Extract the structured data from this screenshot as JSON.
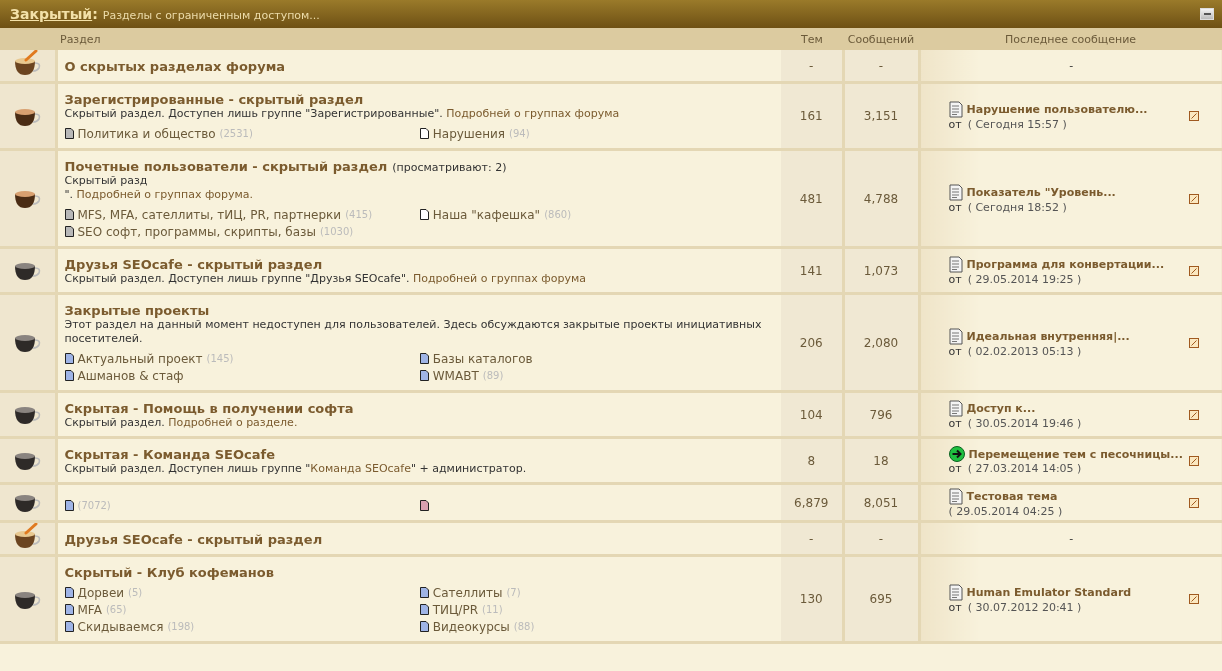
{
  "category": {
    "title": "Закрытый",
    "separator": ":",
    "subtitle": "Разделы с ограниченным доступом...",
    "collapsed": false
  },
  "columns": {
    "forum": "Раздел",
    "topics": "Тем",
    "posts": "Сообщений",
    "last": "Последнее сообщение"
  },
  "forums": [
    {
      "kind": "new",
      "title": "О скрытых разделах форума",
      "topics": "-",
      "posts": "-",
      "last_post": {
        "kind": "none",
        "text": "-"
      }
    },
    {
      "kind": "read",
      "title": "Зарегистрированные - скрытый раздел",
      "description": [
        [
          {
            "text": "Скрытый раздел. Доступен лишь группе \"Зарегистрированные\". ",
            "link": false
          },
          {
            "text": "Подробней о группах форума",
            "link": true
          }
        ]
      ],
      "subforums": {
        "left": [
          {
            "kind": "read",
            "name": "Политика и общество",
            "count": "(2531)"
          }
        ],
        "right": [
          {
            "kind": "empty",
            "name": "Нарушения",
            "count": "(94)"
          }
        ]
      },
      "topics": "161",
      "posts": "3,151",
      "last_post": {
        "kind": "topic",
        "title": "Нарушение пользователю...",
        "by": "от",
        "when": "( Сегодня 15:57 )"
      }
    },
    {
      "kind": "read",
      "title": "Почетные пользователи - скрытый раздел",
      "viewing": "(просматривают: 2)",
      "description": [
        [
          {
            "text": "Скрытый разд",
            "link": false
          }
        ],
        [
          {
            "text": "\". ",
            "link": false
          },
          {
            "text": "Подробней о группах форума.",
            "link": true
          }
        ]
      ],
      "subforums": {
        "left": [
          {
            "kind": "read",
            "name": "MFS, MFA, сателлиты, тИЦ, PR, партнерки",
            "count": "(415)"
          },
          {
            "kind": "read",
            "name": "SEO софт, программы, скрипты, базы",
            "count": "(1030)"
          }
        ],
        "right": [
          {
            "kind": "empty",
            "name": "Наша \"кафешка\"",
            "count": "(860)"
          }
        ]
      },
      "topics": "481",
      "posts": "4,788",
      "last_post": {
        "kind": "topic",
        "title": "Показатель \"Уровень...",
        "by": "от",
        "when": "( Сегодня 18:52 )"
      }
    },
    {
      "kind": "dark",
      "title": "Друзья SEOcafe - скрытый раздел",
      "description": [
        [
          {
            "text": "Скрытый раздел. Доступен лишь группе \"Друзья SEOcafe\". ",
            "link": false
          },
          {
            "text": "Подробней о группах форума",
            "link": true
          }
        ]
      ],
      "topics": "141",
      "posts": "1,073",
      "last_post": {
        "kind": "topic",
        "title": "Программа для конвертации...",
        "by": "от",
        "when": "( 29.05.2014 19:25 )"
      }
    },
    {
      "kind": "dark",
      "title": "Закрытые проекты",
      "description": [
        [
          {
            "text": "Этот раздел на данный момент недоступен для пользователей. Здесь обсуждаются закрытые проекты инициативных посетителей.",
            "link": false
          }
        ]
      ],
      "subforums": {
        "left": [
          {
            "kind": "unread",
            "name": "Актуальный проект",
            "count": "(145)"
          },
          {
            "kind": "unread",
            "name": "Ашманов & стаф"
          }
        ],
        "right": [
          {
            "kind": "unread",
            "name": "Базы каталогов"
          },
          {
            "kind": "unread",
            "name": "WMABT",
            "count": "(89)"
          }
        ]
      },
      "topics": "206",
      "posts": "2,080",
      "last_post": {
        "kind": "topic",
        "title": "Идеальная внутренняя|...",
        "by": "от",
        "when": "( 02.02.2013 05:13 )"
      }
    },
    {
      "kind": "dark",
      "title": "Скрытая - Помощь в получении софта",
      "description": [
        [
          {
            "text": "Скрытый раздел. ",
            "link": false
          },
          {
            "text": "Подробней о разделе.",
            "link": true
          }
        ]
      ],
      "topics": "104",
      "posts": "796",
      "last_post": {
        "kind": "topic",
        "title": "Доступ к...",
        "by": "от",
        "when": "( 30.05.2014 19:46 )"
      }
    },
    {
      "kind": "dark",
      "title": "Скрытая - Команда SEOcafe",
      "description": [
        [
          {
            "text": "Скрытый раздел. Доступен лишь группе \"",
            "link": false
          },
          {
            "text": "Команда SEOcafe",
            "link": true
          },
          {
            "text": "\" + администратор.",
            "link": false
          }
        ]
      ],
      "topics": "8",
      "posts": "18",
      "last_post": {
        "kind": "moved",
        "title": "Перемещение тем с песочницы...",
        "by": "от",
        "when": "( 27.03.2014 14:05 )"
      }
    },
    {
      "kind": "dark",
      "subforums": {
        "left": [
          {
            "kind": "unread",
            "count": "(7072)"
          }
        ],
        "right": [
          {
            "kind": "locked"
          }
        ]
      },
      "topics": "6,879",
      "posts": "8,051",
      "last_post": {
        "kind": "topic",
        "title": "Тестовая тема",
        "when": "( 29.05.2014 04:25 )"
      }
    },
    {
      "kind": "new",
      "title": "Друзья SEOcafe - скрытый раздел",
      "topics": "-",
      "posts": "-",
      "last_post": {
        "kind": "none",
        "text": "-"
      }
    },
    {
      "kind": "dark",
      "title": "Скрытый - Клуб кофеманов",
      "subforums": {
        "left": [
          {
            "kind": "unread",
            "name": "Дорвеи",
            "count": "(5)"
          },
          {
            "kind": "unread",
            "name": "MFA",
            "count": "(65)"
          },
          {
            "kind": "unread",
            "name": "Скидываемся",
            "count": "(198)"
          }
        ],
        "right": [
          {
            "kind": "unread",
            "name": "Сателлиты",
            "count": "(7)"
          },
          {
            "kind": "unread",
            "name": "ТИЦ/PR",
            "count": "(11)"
          },
          {
            "kind": "unread",
            "name": "Видеокурсы",
            "count": "(88)"
          }
        ]
      },
      "topics": "130",
      "posts": "695",
      "last_post": {
        "kind": "topic",
        "title": "Human Emulator Standard",
        "by": "от",
        "when": "( 30.07.2012 20:41 )"
      }
    }
  ]
}
